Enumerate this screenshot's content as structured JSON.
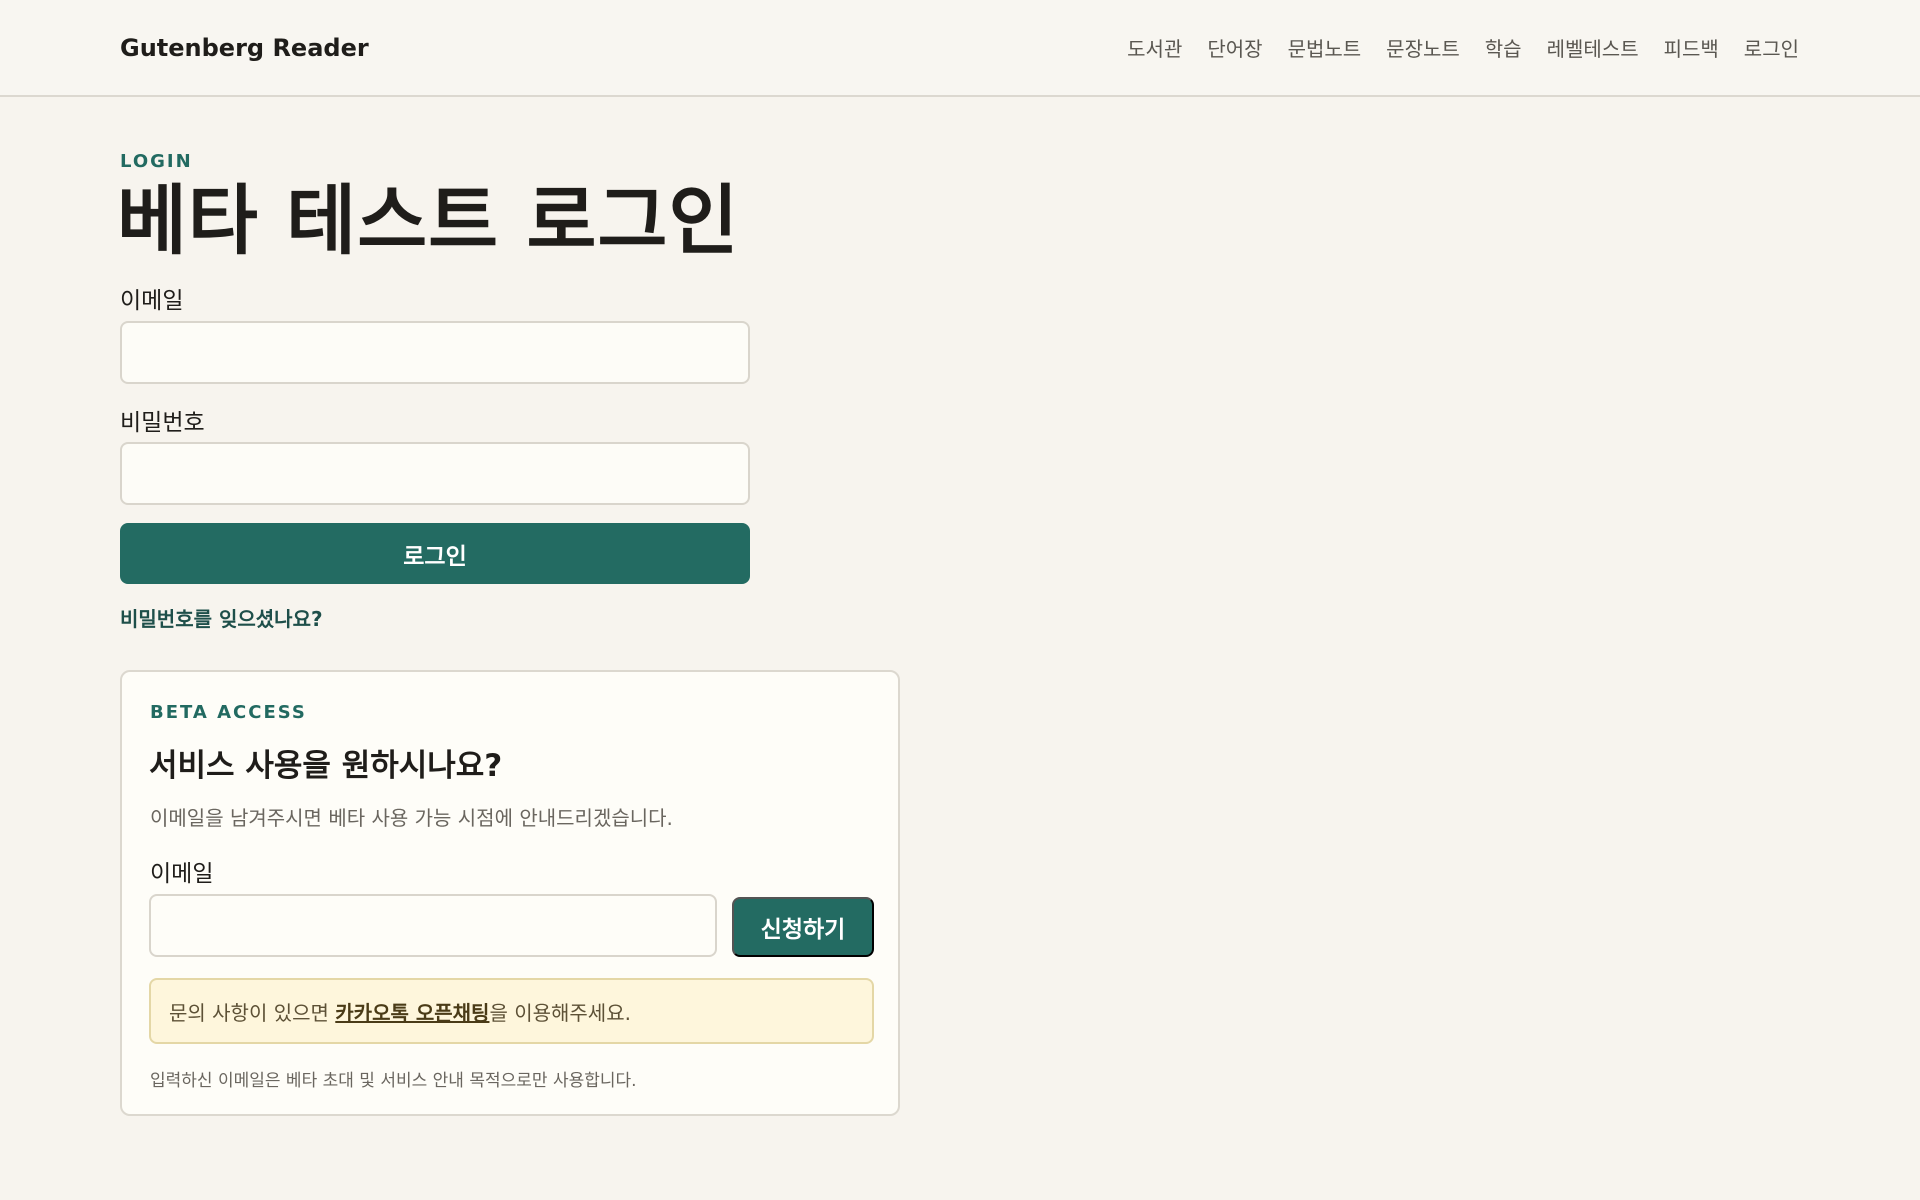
{
  "header": {
    "brand": "Gutenberg Reader",
    "nav": [
      "도서관",
      "단어장",
      "문법노트",
      "문장노트",
      "학습",
      "레벨테스트",
      "피드백",
      "로그인"
    ]
  },
  "login": {
    "eyebrow": "LOGIN",
    "title": "베타 테스트 로그인",
    "email_label": "이메일",
    "email_value": "",
    "password_label": "비밀번호",
    "password_value": "",
    "submit_label": "로그인",
    "forgot_label": "비밀번호를 잊으셨나요?"
  },
  "beta": {
    "eyebrow": "BETA ACCESS",
    "title": "서비스 사용을 원하시나요?",
    "description": "이메일을 남겨주시면 베타 사용 가능 시점에 안내드리겠습니다.",
    "email_label": "이메일",
    "email_value": "",
    "submit_label": "신청하기",
    "notice_prefix": "문의 사항이 있으면 ",
    "notice_link": "카카오톡 오픈채팅",
    "notice_suffix": "을 이용해주세요.",
    "footnote": "입력하신 이메일은 베타 초대 및 서비스 안내 목적으로만 사용합니다."
  },
  "colors": {
    "background": "#f7f4ee",
    "accent": "#236b62",
    "notice_bg": "#fef6dc"
  }
}
